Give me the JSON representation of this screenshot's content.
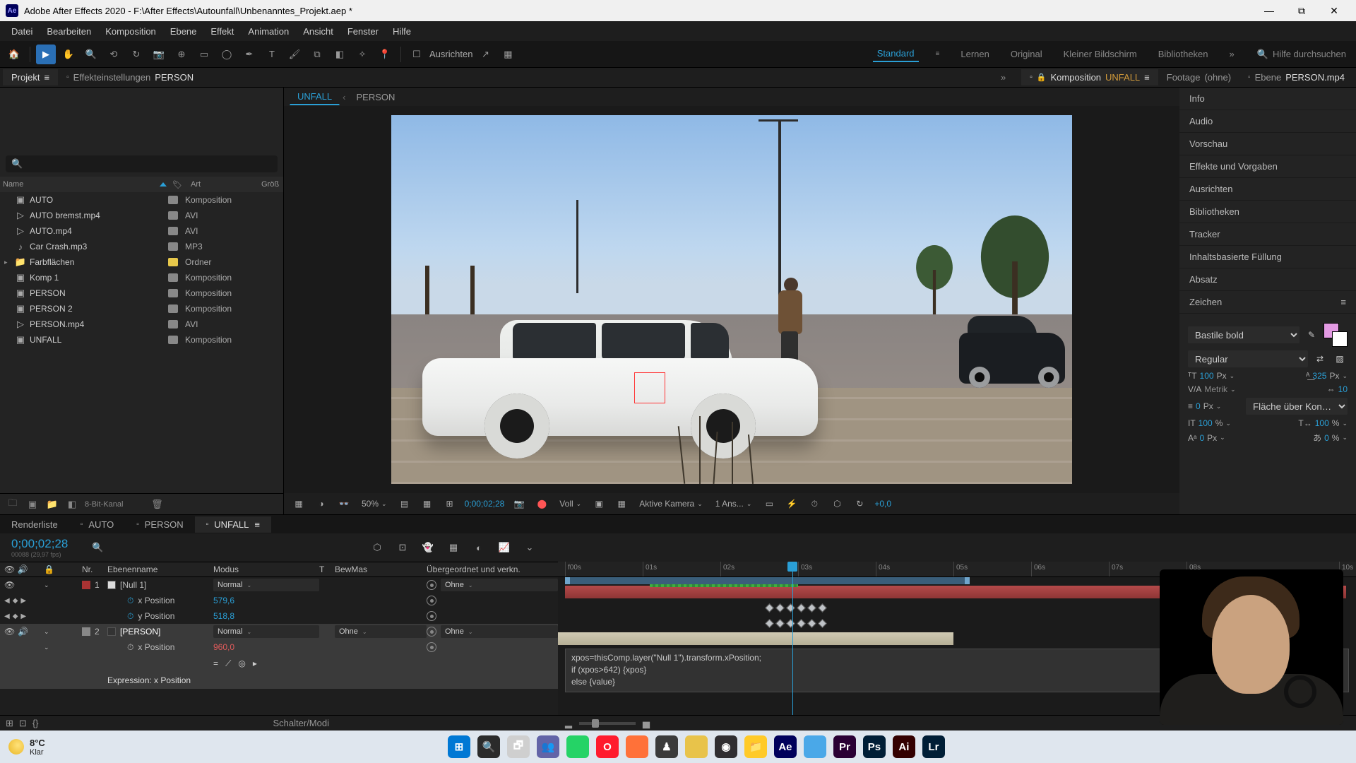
{
  "title": "Adobe After Effects 2020 - F:\\After Effects\\Autounfall\\Unbenanntes_Projekt.aep *",
  "menu": [
    "Datei",
    "Bearbeiten",
    "Komposition",
    "Ebene",
    "Effekt",
    "Animation",
    "Ansicht",
    "Fenster",
    "Hilfe"
  ],
  "toolbar": {
    "ausrichten": "Ausrichten"
  },
  "workspaces": [
    "Standard",
    "Lernen",
    "Original",
    "Kleiner Bildschirm",
    "Bibliotheken"
  ],
  "workspace_active": "Standard",
  "search_help": "Hilfe durchsuchen",
  "top_tabs": {
    "projekt": "Projekt",
    "effekt": {
      "label": "Effekteinstellungen",
      "target": "PERSON"
    },
    "comp": {
      "label": "Komposition",
      "target": "UNFALL"
    },
    "footage": {
      "label": "Footage",
      "target": "(ohne)"
    },
    "layer": {
      "label": "Ebene",
      "target": "PERSON.mp4"
    }
  },
  "viewer_tabs": [
    "UNFALL",
    "PERSON"
  ],
  "project": {
    "columns": {
      "name": "Name",
      "type": "Art",
      "size": "Größ"
    },
    "items": [
      {
        "name": "AUTO",
        "kind": "Komposition",
        "icon": "comp",
        "color": "#888"
      },
      {
        "name": "AUTO bremst.mp4",
        "kind": "AVI",
        "icon": "video",
        "color": "#888"
      },
      {
        "name": "AUTO.mp4",
        "kind": "AVI",
        "icon": "video",
        "color": "#888"
      },
      {
        "name": "Car Crash.mp3",
        "kind": "MP3",
        "icon": "audio",
        "color": "#888"
      },
      {
        "name": "Farbflächen",
        "kind": "Ordner",
        "icon": "folder",
        "color": "#e7c84b",
        "twirl": true
      },
      {
        "name": "Komp 1",
        "kind": "Komposition",
        "icon": "comp",
        "color": "#888"
      },
      {
        "name": "PERSON",
        "kind": "Komposition",
        "icon": "comp",
        "color": "#888"
      },
      {
        "name": "PERSON 2",
        "kind": "Komposition",
        "icon": "comp",
        "color": "#888"
      },
      {
        "name": "PERSON.mp4",
        "kind": "AVI",
        "icon": "video",
        "color": "#888"
      },
      {
        "name": "UNFALL",
        "kind": "Komposition",
        "icon": "comp",
        "color": "#888"
      }
    ],
    "footer_depth": "8-Bit-Kanal"
  },
  "viewer_ctrl": {
    "zoom": "50%",
    "timecode": "0;00;02;28",
    "res": "Voll",
    "camera": "Aktive Kamera",
    "views": "1 Ans...",
    "exposure": "+0,0"
  },
  "right_panels": [
    "Info",
    "Audio",
    "Vorschau",
    "Effekte und Vorgaben",
    "Ausrichten",
    "Bibliotheken",
    "Tracker",
    "Inhaltsbasierte Füllung",
    "Absatz"
  ],
  "char": {
    "title": "Zeichen",
    "font": "Bastile bold",
    "style": "Regular",
    "size": "100",
    "size_unit": "Px",
    "leading": "325",
    "leading_unit": "Px",
    "kerning": "Metrik",
    "tracking": "10",
    "stroke": "0",
    "stroke_unit": "Px",
    "stroke_opt": "Fläche über Kon…",
    "vscale": "100",
    "vscale_unit": "%",
    "hscale": "100",
    "hscale_unit": "%",
    "baseline": "0",
    "baseline_unit": "Px",
    "tsume": "0",
    "tsume_unit": "%"
  },
  "timeline": {
    "tabs": [
      "Renderliste",
      "AUTO",
      "PERSON",
      "UNFALL"
    ],
    "active_tab": "UNFALL",
    "timecode": "0;00;02;28",
    "tc_sub": "00088 (29,97 fps)",
    "cols": {
      "num": "Nr.",
      "name": "Ebenenname",
      "mode": "Modus",
      "t": "T",
      "trk": "BewMas",
      "parent": "Übergeordnet und verkn."
    },
    "ruler": [
      "f00s",
      "01s",
      "02s",
      "03s",
      "04s",
      "05s",
      "06s",
      "07s",
      "08s",
      "10s"
    ],
    "layers": [
      {
        "num": "1",
        "name": "[Null 1]",
        "mode": "Normal",
        "trk": "",
        "parent": "Ohne",
        "sel": false,
        "props": [
          {
            "name": "x Position",
            "value": "579,6",
            "kf": true
          },
          {
            "name": "y Position",
            "value": "518,8",
            "kf": true
          }
        ]
      },
      {
        "num": "2",
        "name": "[PERSON]",
        "mode": "Normal",
        "trk": "Ohne",
        "parent": "Ohne",
        "sel": true,
        "props": [
          {
            "name": "x Position",
            "value": "960,0",
            "red": true,
            "expr": true
          }
        ]
      }
    ],
    "expression_label": "Expression: x Position",
    "expression": "xpos=thisComp.layer(\"Null 1\").transform.xPosition;\nif (xpos>642) {xpos}\nelse {value}",
    "footer": "Schalter/Modi"
  },
  "taskbar": {
    "temp": "8°C",
    "cond": "Klar",
    "apps": [
      {
        "name": "windows",
        "bg": "#0078d4",
        "txt": "⊞"
      },
      {
        "name": "search",
        "bg": "#2b2b2b",
        "txt": "🔍"
      },
      {
        "name": "taskview",
        "bg": "#cfcfcf",
        "txt": "🗗"
      },
      {
        "name": "teams",
        "bg": "#6264a7",
        "txt": "👥"
      },
      {
        "name": "whatsapp",
        "bg": "#25d366",
        "txt": ""
      },
      {
        "name": "opera",
        "bg": "#ff1b2d",
        "txt": "O"
      },
      {
        "name": "firefox",
        "bg": "#ff7139",
        "txt": ""
      },
      {
        "name": "app1",
        "bg": "#3b3b3b",
        "txt": "♟"
      },
      {
        "name": "app2",
        "bg": "#e8c34a",
        "txt": ""
      },
      {
        "name": "obs",
        "bg": "#302e31",
        "txt": "◉"
      },
      {
        "name": "explorer",
        "bg": "#ffca28",
        "txt": "📁"
      },
      {
        "name": "ae",
        "bg": "#00005b",
        "txt": "Ae"
      },
      {
        "name": "app3",
        "bg": "#4aa8e8",
        "txt": ""
      },
      {
        "name": "pr",
        "bg": "#2a0034",
        "txt": "Pr"
      },
      {
        "name": "ps",
        "bg": "#001e36",
        "txt": "Ps"
      },
      {
        "name": "ai",
        "bg": "#330000",
        "txt": "Ai"
      },
      {
        "name": "lr",
        "bg": "#001e36",
        "txt": "Lr"
      }
    ]
  }
}
